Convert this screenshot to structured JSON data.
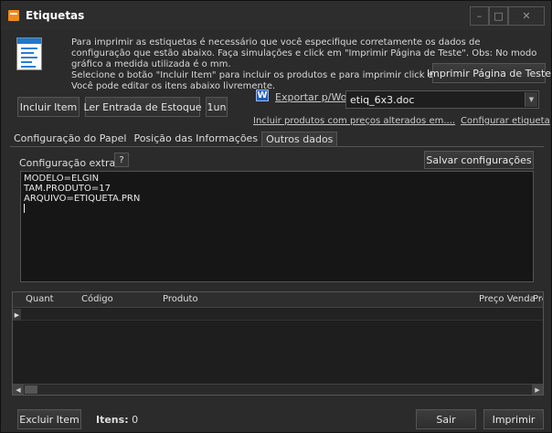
{
  "window": {
    "title": "Etiquetas",
    "controls": {
      "minimize": "–",
      "maximize": "□",
      "close": "✕"
    }
  },
  "header": {
    "info_text": "Para imprimir as estiquetas é necessário que você especifique corretamente os dados de configuração que estão abaixo.  Faça simulações e click em \"Imprimir Página de Teste\". Obs: No modo gráfico a medida utilizada é o mm.\n Selecione o botão \"Incluir Item\" para incluir os produtos e para imprimir click em \"Imprimir\". Dica: Você pode editar os itens abaixo livremente.",
    "print_test_button": "Imprimir Página de Teste"
  },
  "toolbar": {
    "include_item": "Incluir Item",
    "read_stock_entry": "Ler Entrada de Estoque",
    "un_button": "1un",
    "export_word": "Exportar p/Word",
    "file_select_value": "etiq_6x3.doc",
    "include_altered_prices": "Incluir produtos com preços alterados em....",
    "configure_label": "Configurar etiqueta"
  },
  "tabs": [
    {
      "label": "Configuração do Papel",
      "active": false
    },
    {
      "label": "Posição das Informações",
      "active": false
    },
    {
      "label": "Outros dados",
      "active": true
    }
  ],
  "config": {
    "extra_label": "Configuração extra:",
    "help_button": "?",
    "save_button": "Salvar configurações",
    "lines": [
      "MODELO=ELGIN",
      "TAM.PRODUTO=17",
      "ARQUIVO=ETIQUETA.PRN"
    ]
  },
  "grid": {
    "columns": [
      "Quant",
      "Código",
      "Produto",
      "Preço Venda",
      "Prec"
    ]
  },
  "footer": {
    "delete_item": "Excluir Item",
    "items_label": "Itens:",
    "items_count": "0",
    "exit_button": "Sair",
    "print_button": "Imprimir"
  },
  "colors": {
    "background": "#2b2b2b",
    "app_icon": "#f08a1c",
    "word_icon": "#1f5fbf"
  }
}
